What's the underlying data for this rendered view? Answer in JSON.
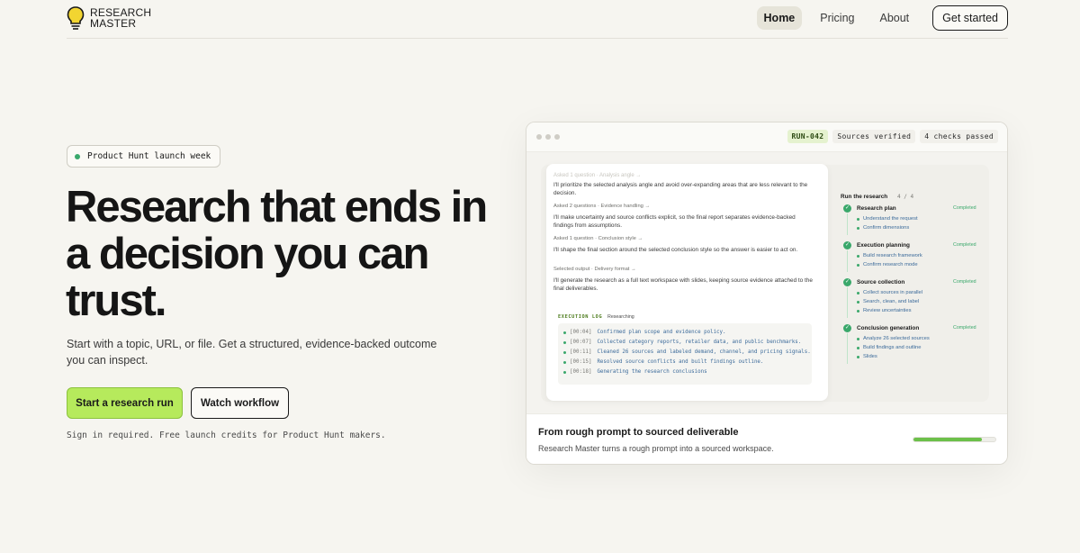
{
  "brand": {
    "line1": "RESEARCH",
    "line2": "MASTER",
    "icon": "lightbulb-icon",
    "accent": "#b6ea5c"
  },
  "nav": {
    "items": [
      {
        "label": "Home",
        "active": true
      },
      {
        "label": "Pricing",
        "active": false
      },
      {
        "label": "About",
        "active": false
      }
    ],
    "cta": "Get started"
  },
  "hero": {
    "badge": "Product Hunt launch week",
    "title": "Research that ends in a decision you can trust.",
    "subtitle": "Start with a topic, URL, or file. Get a structured, evidence-backed outcome you can inspect.",
    "primary_button": "Start a research run",
    "secondary_button": "Watch workflow",
    "fine_print": "Sign in required. Free launch credits for Product Hunt makers."
  },
  "demo": {
    "chips": [
      "RUN-042",
      "Sources verified",
      "4 checks passed"
    ],
    "chat": {
      "faded": "Asked 1 question · Analysis angle →",
      "lines": [
        "I'll prioritize the selected analysis angle and avoid over-expanding areas that are less relevant to the decision.",
        "Asked 2 questions · Evidence handling →",
        "I'll make uncertainty and source conflicts explicit, so the final report separates evidence-backed findings from assumptions.",
        "Asked 1 question · Conclusion style →",
        "I'll shape the final section around the selected conclusion style so the answer is easier to act on.",
        "Selected output · Delivery format →",
        "I'll generate the research as a full text workspace with slides, keeping source evidence attached to the final deliverables."
      ],
      "exec_label": "EXECUTION LOG",
      "exec_status": "Researching",
      "log": [
        {
          "ts": "[00:04]",
          "text": "Confirmed plan scope and evidence policy."
        },
        {
          "ts": "[00:07]",
          "text": "Collected category reports, retailer data, and public benchmarks."
        },
        {
          "ts": "[00:11]",
          "text": "Cleaned 26 sources and labeled demand, channel, and pricing signals."
        },
        {
          "ts": "[00:15]",
          "text": "Resolved source conflicts and built findings outline."
        },
        {
          "ts": "[00:18]",
          "text": "Generating the research conclusions"
        }
      ]
    },
    "runs": {
      "title": "Run the research",
      "count": "4 / 4",
      "stages": [
        {
          "title": "Research plan",
          "status": "Completed",
          "steps": [
            "Understand the request",
            "Confirm dimensions"
          ]
        },
        {
          "title": "Execution planning",
          "status": "Completed",
          "steps": [
            "Build research framework",
            "Confirm research mode"
          ]
        },
        {
          "title": "Source collection",
          "status": "Completed",
          "steps": [
            "Collect sources in parallel",
            "Search, clean, and label",
            "Review uncertainties"
          ]
        },
        {
          "title": "Conclusion generation",
          "status": "Completed",
          "steps": [
            "Analyze 26 selected sources",
            "Build findings and outline",
            "Slides"
          ]
        }
      ]
    },
    "footer": {
      "title": "From rough prompt to sourced deliverable",
      "subtitle": "Research Master turns a rough prompt into a sourced workspace.",
      "progress": 0.84
    }
  }
}
